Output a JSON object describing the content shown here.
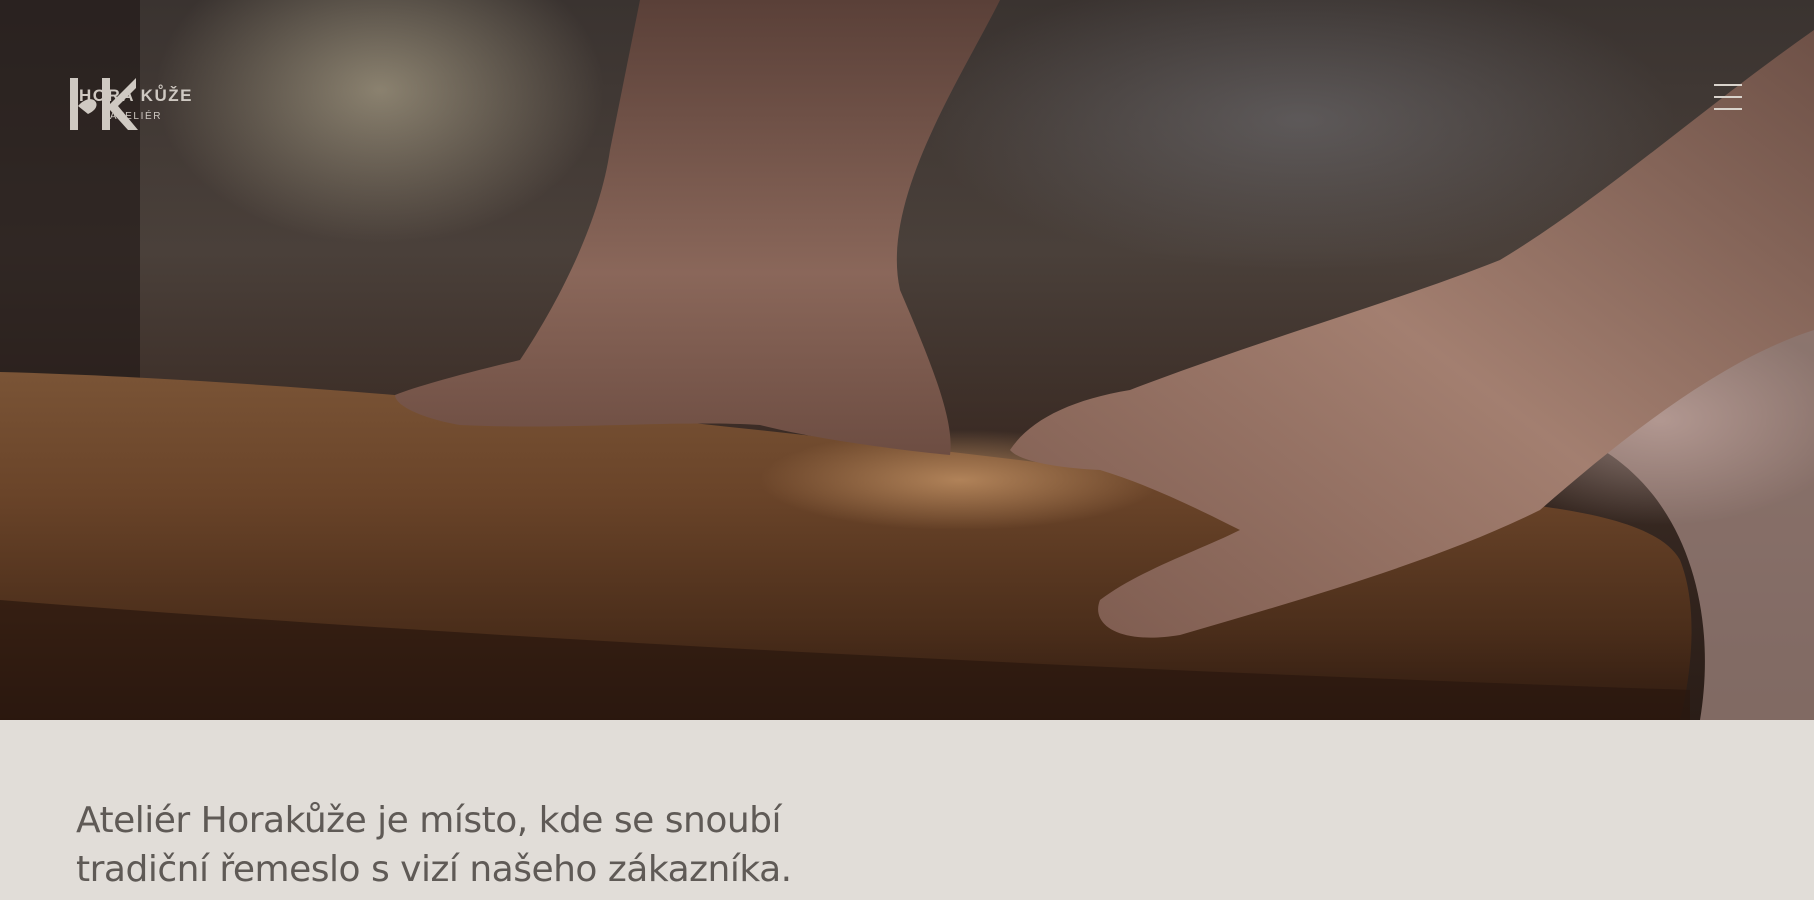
{
  "header": {
    "logo": {
      "monogram": "HK",
      "name": "HORA KŮŽE",
      "subtitle": "ATELIÉR"
    },
    "menu_icon": "hamburger-menu-icon"
  },
  "hero": {
    "image_description_icon": "leather-roll-photo"
  },
  "intro": {
    "line1": "Ateliér Horakůže je místo, kde se snoubí",
    "line2": "tradiční řemeslo s vizí našeho zákazníka."
  },
  "colors": {
    "page_background": "#e1ddd8",
    "text": "#5f5a56",
    "logo": "#cfc9c2"
  }
}
